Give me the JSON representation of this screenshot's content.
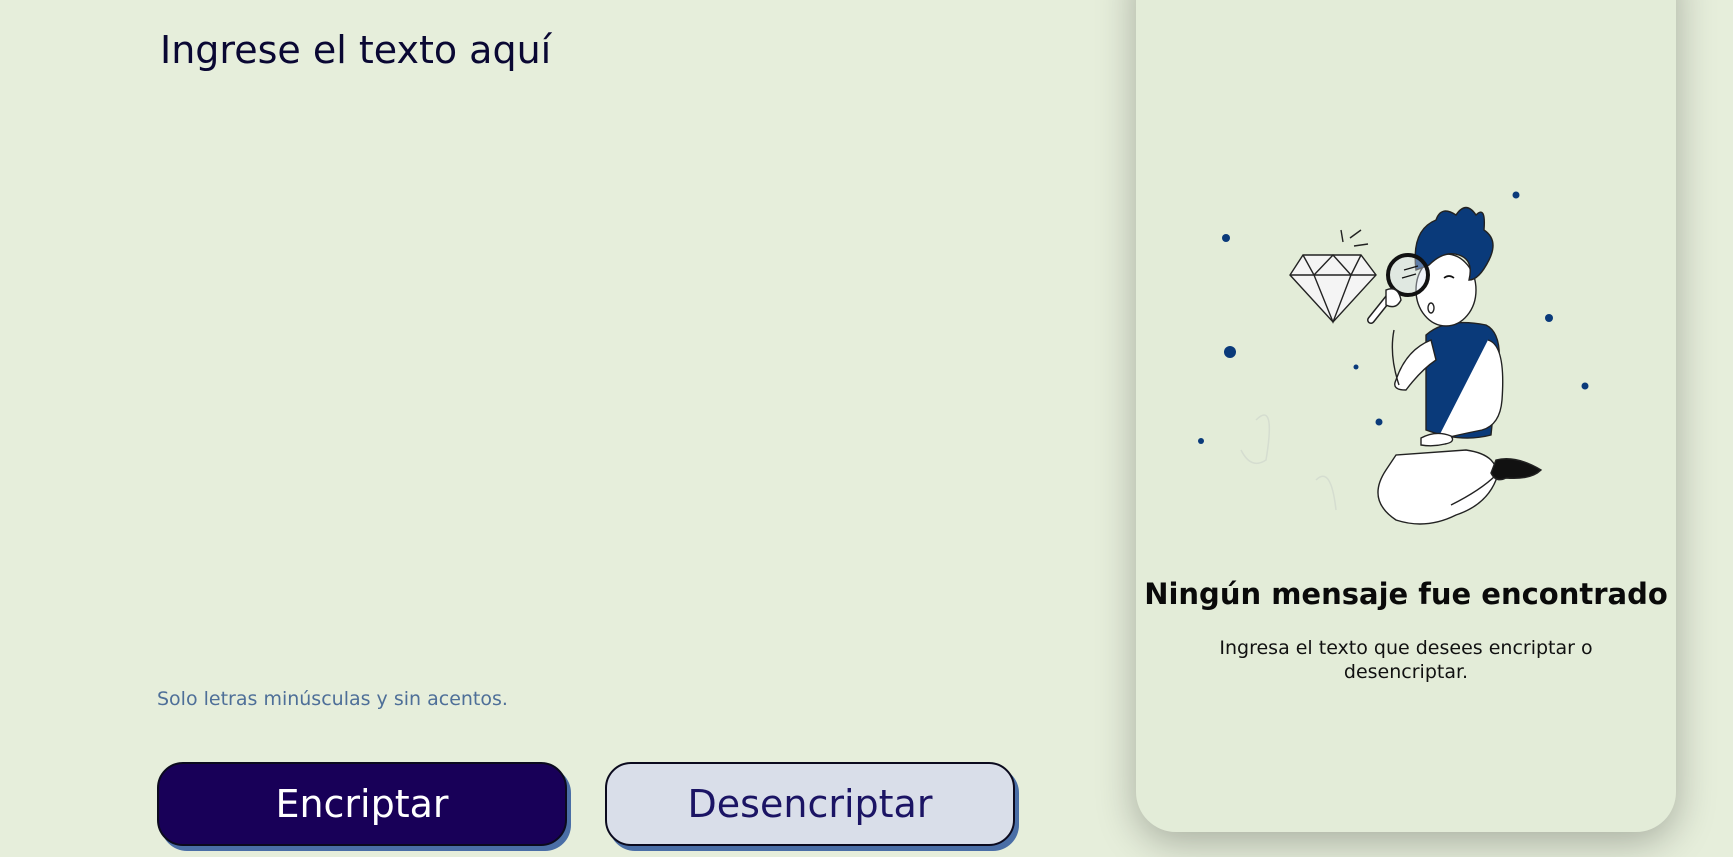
{
  "input": {
    "placeholder": "Ingrese el texto aquí",
    "value": ""
  },
  "hint": {
    "text": "Solo letras minúsculas y sin acentos."
  },
  "buttons": {
    "encrypt_label": "Encriptar",
    "decrypt_label": "Desencriptar"
  },
  "result": {
    "title": "Ningún mensaje fue encontrado",
    "text": "Ingresa el texto que desees encriptar o desencriptar."
  },
  "colors": {
    "background": "#e6eedb",
    "primary": "#180058",
    "secondary": "#d9dee9",
    "hint": "#4e6f98",
    "accent_blue": "#0a3a7a"
  },
  "icons": {
    "illustration": "person-with-magnifying-glass-and-diamond"
  }
}
